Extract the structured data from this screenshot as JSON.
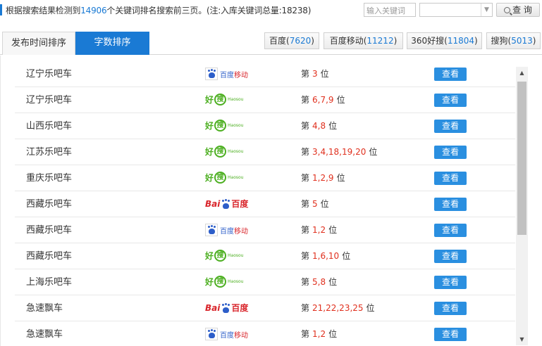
{
  "summary": {
    "prefix": "根据搜索结果检测到",
    "count": "14906",
    "suffix": "个关键词排名搜索前三页。(注:入库关键词总量:18238)"
  },
  "search": {
    "placeholder": "输入关键词",
    "select_value": "",
    "query_label": "查 询"
  },
  "tabs": [
    {
      "label": "发布时间排序",
      "active": false
    },
    {
      "label": "字数排序",
      "active": true
    }
  ],
  "engines": [
    {
      "name": "百度",
      "count": "7620"
    },
    {
      "name": "百度移动",
      "count": "11212"
    },
    {
      "name": "360好搜",
      "count": "11804"
    },
    {
      "name": "搜狗",
      "count": "5013"
    }
  ],
  "rank_prefix": "第",
  "rank_suffix": "位",
  "view_label": "查看",
  "logos": {
    "baidu_mobile": {
      "text_baidu": "百度",
      "text_mobile": "移动"
    },
    "haosou": {
      "hao": "好",
      "sou": "搜",
      "en": "Haosou"
    },
    "baidu": {
      "bai": "Bai",
      "du": "百度"
    }
  },
  "rows": [
    {
      "keyword": "辽宁乐吧车",
      "engine": "baidu_mobile",
      "positions": "3"
    },
    {
      "keyword": "辽宁乐吧车",
      "engine": "haosou",
      "positions": "6,7,9"
    },
    {
      "keyword": "山西乐吧车",
      "engine": "haosou",
      "positions": "4,8"
    },
    {
      "keyword": "江苏乐吧车",
      "engine": "haosou",
      "positions": "3,4,18,19,20"
    },
    {
      "keyword": "重庆乐吧车",
      "engine": "haosou",
      "positions": "1,2,9"
    },
    {
      "keyword": "西藏乐吧车",
      "engine": "baidu",
      "positions": "5"
    },
    {
      "keyword": "西藏乐吧车",
      "engine": "baidu_mobile",
      "positions": "1,2"
    },
    {
      "keyword": "西藏乐吧车",
      "engine": "haosou",
      "positions": "1,6,10"
    },
    {
      "keyword": "上海乐吧车",
      "engine": "haosou",
      "positions": "5,8"
    },
    {
      "keyword": "急速飘车",
      "engine": "baidu",
      "positions": "21,22,23,25"
    },
    {
      "keyword": "急速飘车",
      "engine": "baidu_mobile",
      "positions": "1,2"
    }
  ],
  "colors": {
    "accent": "#1a7ad4",
    "rank_red": "#e0301e",
    "button_blue": "#2a8fe0",
    "haosou_green": "#4caf20"
  }
}
